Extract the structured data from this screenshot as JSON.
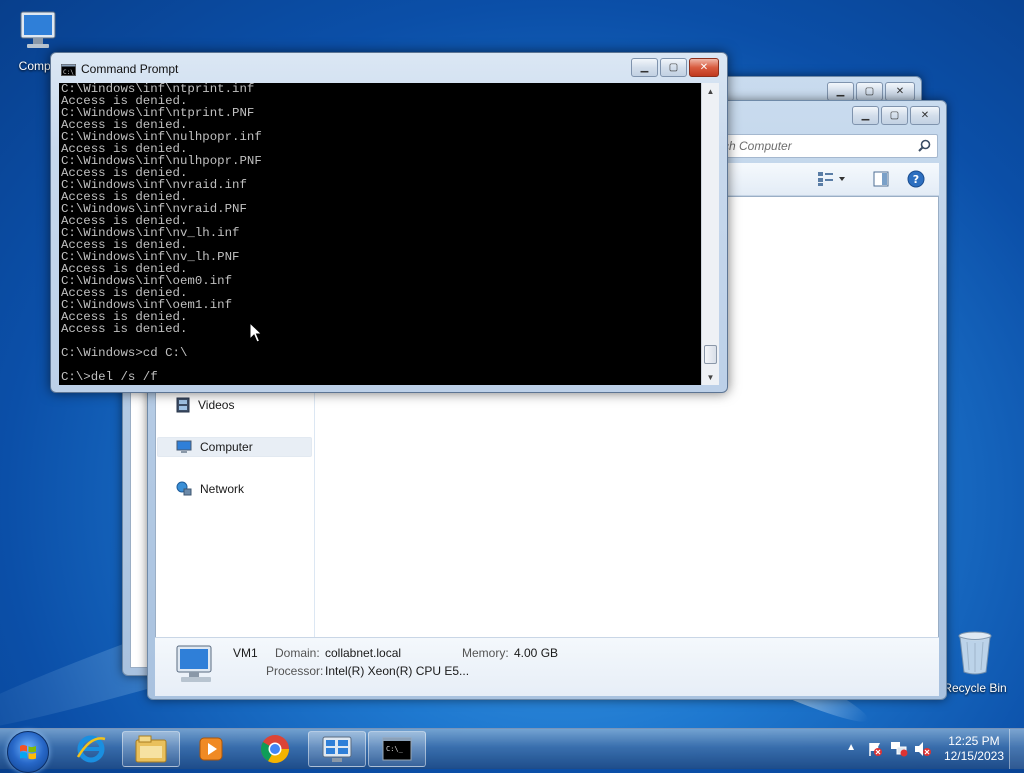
{
  "desktop": {
    "computer_icon_label": "Compu",
    "recycle_bin_label": "Recycle Bin"
  },
  "cmd": {
    "title": "Command Prompt",
    "lines": [
      "C:\\Windows\\inf\\ntprint.inf",
      "Access is denied.",
      "C:\\Windows\\inf\\ntprint.PNF",
      "Access is denied.",
      "C:\\Windows\\inf\\nulhpopr.inf",
      "Access is denied.",
      "C:\\Windows\\inf\\nulhpopr.PNF",
      "Access is denied.",
      "C:\\Windows\\inf\\nvraid.inf",
      "Access is denied.",
      "C:\\Windows\\inf\\nvraid.PNF",
      "Access is denied.",
      "C:\\Windows\\inf\\nv_lh.inf",
      "Access is denied.",
      "C:\\Windows\\inf\\nv_lh.PNF",
      "Access is denied.",
      "C:\\Windows\\inf\\oem0.inf",
      "Access is denied.",
      "C:\\Windows\\inf\\oem1.inf",
      "Access is denied.",
      "Access is denied.",
      "",
      "C:\\Windows>cd C:\\",
      "",
      "C:\\>del /s /f"
    ]
  },
  "explorer": {
    "search_placeholder": "rch Computer",
    "nav": {
      "videos": "Videos",
      "computer": "Computer",
      "network": "Network"
    },
    "details": {
      "name": "VM1",
      "domain_label": "Domain:",
      "domain_value": "collabnet.local",
      "memory_label": "Memory:",
      "memory_value": "4.00 GB",
      "processor_label": "Processor:",
      "processor_value": "Intel(R) Xeon(R) CPU E5..."
    }
  },
  "taskbar": {
    "time": "12:25 PM",
    "date": "12/15/2023"
  }
}
